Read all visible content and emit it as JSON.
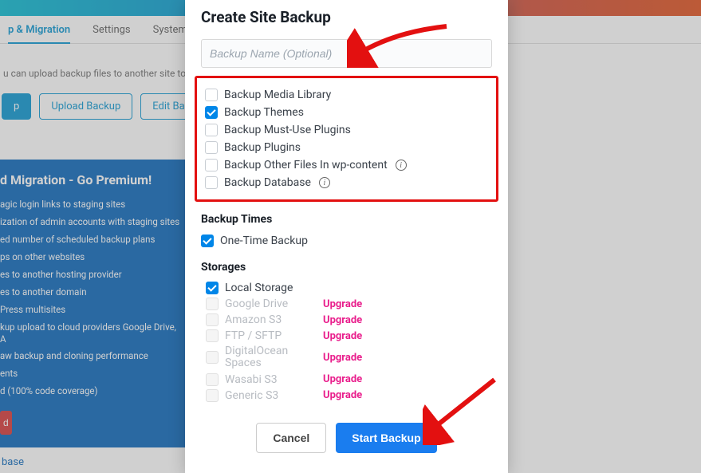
{
  "bg": {
    "tab_active": "p & Migration",
    "tab_settings": "Settings",
    "tab_system": "System Info",
    "desc": "u can upload backup files to another site to tran",
    "btn_backup": "p",
    "btn_upload": "Upload Backup",
    "btn_edit": "Edit Backu"
  },
  "premium": {
    "title": "d Migration - Go Premium!",
    "items": [
      "agic login links to staging sites",
      "ization of admin accounts with staging sites",
      "ed number of scheduled backup plans",
      "ps on other websites",
      "es to another hosting provider",
      "es to another domain",
      "Press multisites",
      "kup upload to cloud providers Google Drive, A",
      "aw backup and cloning performance",
      "ents",
      "d (100% code coverage)"
    ],
    "cta": "d",
    "footer_link": "base"
  },
  "modal": {
    "title": "Create Site Backup",
    "placeholder": "Backup Name (Optional)",
    "options": [
      {
        "label": "Backup Media Library",
        "checked": false,
        "info": false
      },
      {
        "label": "Backup Themes",
        "checked": true,
        "info": false
      },
      {
        "label": "Backup Must-Use Plugins",
        "checked": false,
        "info": false
      },
      {
        "label": "Backup Plugins",
        "checked": false,
        "info": false
      },
      {
        "label": "Backup Other Files In wp-content",
        "checked": false,
        "info": true
      },
      {
        "label": "Backup Database",
        "checked": false,
        "info": true
      }
    ],
    "section_times": "Backup Times",
    "onetime": {
      "label": "One-Time Backup",
      "checked": true
    },
    "section_storages": "Storages",
    "storages": [
      {
        "label": "Local Storage",
        "checked": true,
        "enabled": true,
        "upgrade": ""
      },
      {
        "label": "Google Drive",
        "checked": false,
        "enabled": false,
        "upgrade": "Upgrade"
      },
      {
        "label": "Amazon S3",
        "checked": false,
        "enabled": false,
        "upgrade": "Upgrade"
      },
      {
        "label": "FTP / SFTP",
        "checked": false,
        "enabled": false,
        "upgrade": "Upgrade"
      },
      {
        "label": "DigitalOcean Spaces",
        "checked": false,
        "enabled": false,
        "upgrade": "Upgrade"
      },
      {
        "label": "Wasabi S3",
        "checked": false,
        "enabled": false,
        "upgrade": "Upgrade"
      },
      {
        "label": "Generic S3",
        "checked": false,
        "enabled": false,
        "upgrade": "Upgrade"
      }
    ],
    "btn_cancel": "Cancel",
    "btn_start": "Start Backup"
  },
  "colors": {
    "accent": "#0086e8",
    "upgrade": "#e91e8c",
    "annotation": "#e31010"
  }
}
